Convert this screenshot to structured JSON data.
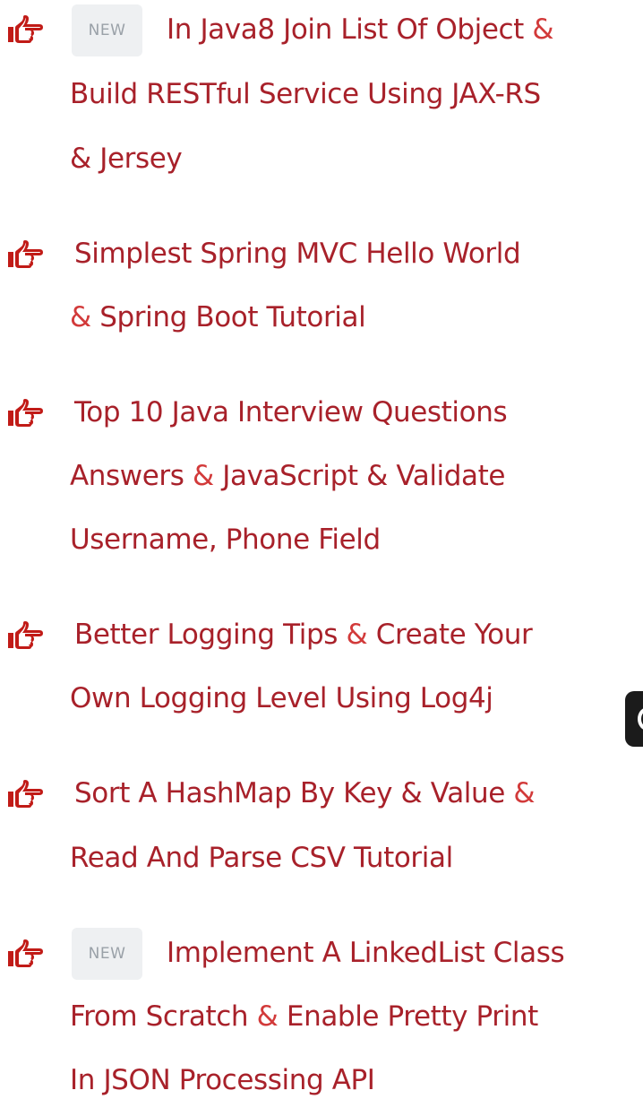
{
  "colors": {
    "link": "#a8212a",
    "ampersand": "#d23a3a",
    "badge_bg": "#eef0f2",
    "badge_text": "#9aa1a8",
    "background": "#ffffff"
  },
  "icons": {
    "bullet": "pointing-hand-icon"
  },
  "items": [
    {
      "badge": "NEW",
      "lines": [
        "In Java8 Join List Of Object",
        "Build RESTful Service Using JAX-RS",
        "Jersey"
      ],
      "amp": "&"
    },
    {
      "lines": [
        "Simplest Spring MVC Hello World",
        "Spring Boot Tutorial"
      ],
      "amp": "&"
    },
    {
      "lines": [
        "Top 10 Java Interview Questions",
        "Answers",
        "JavaScript & Validate",
        "Username, Phone Field"
      ],
      "amp": "&"
    },
    {
      "lines": [
        "Better Logging Tips",
        "Create Your",
        "Own Logging Level Using Log4j"
      ],
      "amp": "&"
    },
    {
      "lines": [
        "Sort A HashMap By Key & Value",
        "Read And Parse CSV Tutorial"
      ],
      "amp": "&"
    },
    {
      "badge": "NEW",
      "lines": [
        "Implement A LinkedList Class",
        "From Scratch",
        "Enable Pretty Print",
        "In JSON Processing API"
      ],
      "amp": "&"
    }
  ]
}
